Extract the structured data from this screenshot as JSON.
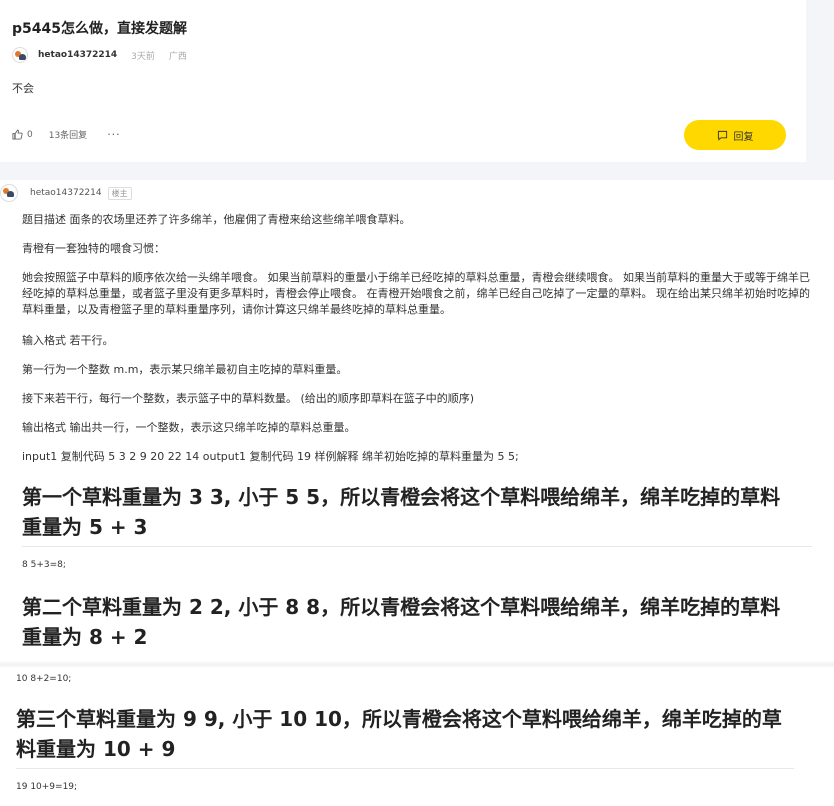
{
  "post": {
    "title": "p5445怎么做，直接发题解",
    "author": "hetao14372214",
    "time": "3天前",
    "location": "广西",
    "body": "不会",
    "likes": "0",
    "reply_count": "13条回复",
    "more": "···",
    "reply_button": "回复"
  },
  "reply": {
    "author": "hetao14372214",
    "badge": "楼主",
    "paragraphs": [
      "题目描述 面条的农场里还养了许多绵羊，他雇佣了青橙来给这些绵羊喂食草料。",
      "青橙有一套独特的喂食习惯：",
      "她会按照篮子中草料的顺序依次给一头绵羊喂食。 如果当前草料的重量小于绵羊已经吃掉的草料总重量，青橙会继续喂食。 如果当前草料的重量大于或等于绵羊已经吃掉的草料总重量，或者篮子里没有更多草料时，青橙会停止喂食。 在青橙开始喂食之前，绵羊已经自己吃掉了一定量的草料。 现在给出某只绵羊初始时吃掉的草料重量，以及青橙篮子里的草料重量序列，请你计算这只绵羊最终吃掉的草料总重量。",
      "输入格式 若干行。",
      "第一行为一个整数 m.m，表示某只绵羊最初自主吃掉的草料重量。",
      "接下来若干行，每行一个整数，表示篮子中的草料数量。 (给出的顺序即草料在篮子中的顺序)",
      "输出格式 输出共一行，一个整数，表示这只绵羊吃掉的草料总重量。",
      "input1 复制代码 5 3 2 9 20 22 14 output1 复制代码 19 样例解释 绵羊初始吃掉的草料重量为 5 5;"
    ],
    "headings": [
      "第一个草料重量为 3 3, 小于 5 5，所以青橙会将这个草料喂给绵羊，绵羊吃掉的草料重量为 5 + 3",
      "第二个草料重量为 2 2, 小于 8 8，所以青橙会将这个草料喂给绵羊，绵羊吃掉的草料重量为 8 + 2",
      "第三个草料重量为 9 9, 小于 10 10，所以青橙会将这个草料喂给绵羊，绵羊吃掉的草料重量为 10 + 9"
    ],
    "calcs": [
      "8 5+3=8;",
      "10 8+2=10;",
      "19 10+9=19;"
    ]
  },
  "colors": {
    "accent": "#ffd800",
    "band": "#f3f5f8"
  }
}
